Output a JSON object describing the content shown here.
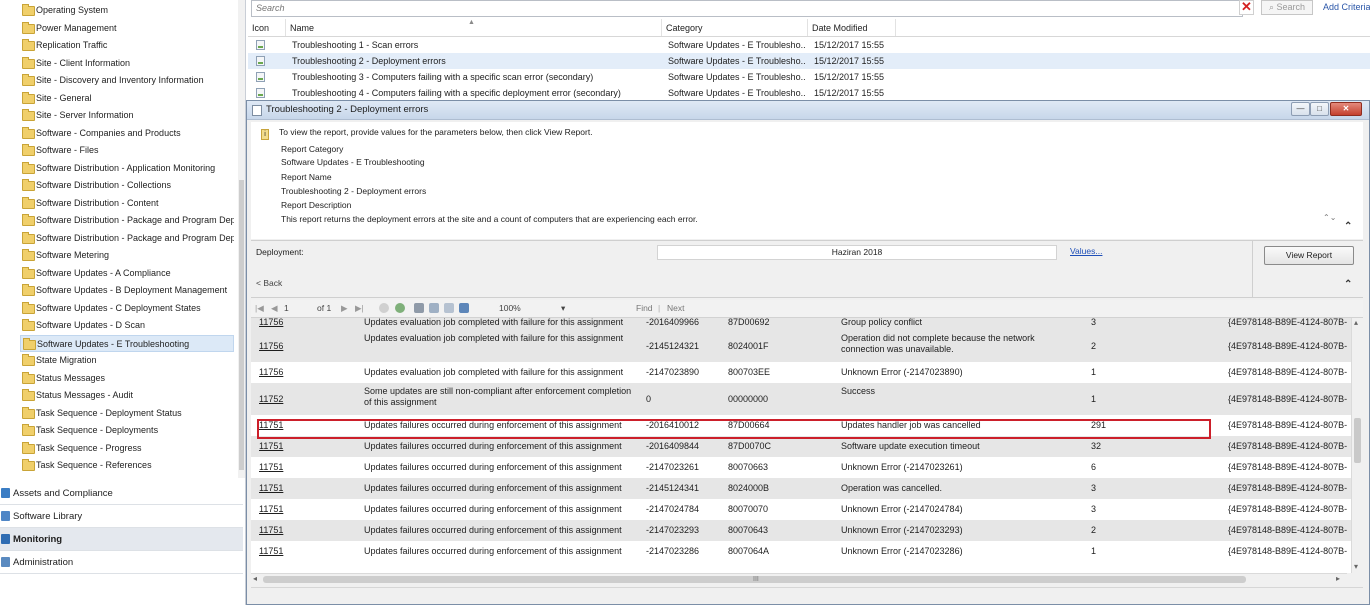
{
  "tree": {
    "items": [
      {
        "label": "Operating System",
        "selected": false
      },
      {
        "label": "Power Management",
        "selected": false
      },
      {
        "label": "Replication Traffic",
        "selected": false
      },
      {
        "label": "Site - Client Information",
        "selected": false
      },
      {
        "label": "Site - Discovery and Inventory Information",
        "selected": false
      },
      {
        "label": "Site - General",
        "selected": false
      },
      {
        "label": "Site - Server Information",
        "selected": false
      },
      {
        "label": "Software - Companies and Products",
        "selected": false
      },
      {
        "label": "Software - Files",
        "selected": false
      },
      {
        "label": "Software Distribution - Application Monitoring",
        "selected": false
      },
      {
        "label": "Software Distribution - Collections",
        "selected": false
      },
      {
        "label": "Software Distribution - Content",
        "selected": false
      },
      {
        "label": "Software Distribution - Package and Program Deplc",
        "selected": false
      },
      {
        "label": "Software Distribution - Package and Program Deplc",
        "selected": false
      },
      {
        "label": "Software Metering",
        "selected": false
      },
      {
        "label": "Software Updates - A Compliance",
        "selected": false
      },
      {
        "label": "Software Updates - B Deployment Management",
        "selected": false
      },
      {
        "label": "Software Updates - C Deployment States",
        "selected": false
      },
      {
        "label": "Software Updates - D Scan",
        "selected": false
      },
      {
        "label": "Software Updates - E Troubleshooting",
        "selected": true
      },
      {
        "label": "State Migration",
        "selected": false
      },
      {
        "label": "Status Messages",
        "selected": false
      },
      {
        "label": "Status Messages - Audit",
        "selected": false
      },
      {
        "label": "Task Sequence - Deployment Status",
        "selected": false
      },
      {
        "label": "Task Sequence - Deployments",
        "selected": false
      },
      {
        "label": "Task Sequence - Progress",
        "selected": false
      },
      {
        "label": "Task Sequence - References",
        "selected": false
      }
    ]
  },
  "workspaces": [
    {
      "label": "Assets and Compliance",
      "color": "#3b7dc4",
      "active": false
    },
    {
      "label": "Software Library",
      "color": "#4f86c6",
      "active": false
    },
    {
      "label": "Monitoring",
      "color": "#2f6db3",
      "active": true
    },
    {
      "label": "Administration",
      "color": "#5a8ac0",
      "active": false
    }
  ],
  "search": {
    "placeholder": "Search",
    "clear_symbol": "✕",
    "button_label": "Search",
    "search_glyph": "⌕",
    "add_criteria": "Add Criteria"
  },
  "list": {
    "columns": {
      "icon": "Icon",
      "name": "Name",
      "category": "Category",
      "date": "Date Modified"
    },
    "sort_glyph": "▲",
    "rows": [
      {
        "name": "Troubleshooting 1 - Scan errors",
        "category": "Software Updates - E Troublesho...",
        "date": "15/12/2017 15:55",
        "selected": false
      },
      {
        "name": "Troubleshooting 2 - Deployment errors",
        "category": "Software Updates - E Troublesho...",
        "date": "15/12/2017 15:55",
        "selected": true
      },
      {
        "name": "Troubleshooting 3 - Computers failing with a specific scan error (secondary)",
        "category": "Software Updates - E Troublesho...",
        "date": "15/12/2017 15:55",
        "selected": false
      },
      {
        "name": "Troubleshooting 4 - Computers failing with a specific deployment error (secondary)",
        "category": "Software Updates - E Troublesho...",
        "date": "15/12/2017 15:55",
        "selected": false
      }
    ]
  },
  "report_window": {
    "title": "Troubleshooting 2 - Deployment errors",
    "minimize": "—",
    "maximize": "□",
    "close": "✕",
    "info": {
      "icon": "i",
      "instruction": "To view the report, provide values for the parameters below, then click View Report.",
      "category_label": "Report Category",
      "category_value": "Software Updates - E Troubleshooting",
      "name_label": "Report Name",
      "name_value": "Troubleshooting 2 - Deployment errors",
      "description_label": "Report Description",
      "description_value": "This report returns the deployment errors at the site and a count of computers that are experiencing each error.",
      "scroll_glyph": "⌃⌄",
      "collapse_glyph": "⌃"
    },
    "params": {
      "deployment_label": "Deployment:",
      "deployment_value": "Haziran 2018",
      "values_link": "Values...",
      "back_link": "< Back",
      "view_report": "View Report",
      "collapse_glyph": "⌃"
    },
    "toolbar": {
      "first": "|◀",
      "prev": "◀",
      "page": "1",
      "of": "of 1",
      "next_page": "▶",
      "last": "▶|",
      "zoom": "100%",
      "zoom_arrow": "▾",
      "find": "Find",
      "next": "Next"
    },
    "table": {
      "rows": [
        {
          "id": "11756",
          "desc": "Updates evaluation job completed with failure for this assignment",
          "code": "-2016409966",
          "hex": "87D00692",
          "error": "Group policy conflict",
          "count": "3",
          "guid": "{4E978148-B89E-4124-807B-"
        },
        {
          "id": "11756",
          "desc": "Updates evaluation job completed with failure for this assignment",
          "code": "-2145124321",
          "hex": "8024001F",
          "error": "Operation did not complete because the network connection was unavailable.",
          "count": "2",
          "guid": "{4E978148-B89E-4124-807B-"
        },
        {
          "id": "11756",
          "desc": "Updates evaluation job completed with failure for this assignment",
          "code": "-2147023890",
          "hex": "800703EE",
          "error": "Unknown Error (-2147023890)",
          "count": "1",
          "guid": "{4E978148-B89E-4124-807B-"
        },
        {
          "id": "11752",
          "desc": "Some updates are still non-compliant after enforcement completion of this assignment",
          "code": "0",
          "hex": "00000000",
          "error": "Success",
          "count": "1",
          "guid": "{4E978148-B89E-4124-807B-"
        },
        {
          "id": "11751",
          "desc": "Updates failures occurred during enforcement of this assignment",
          "code": "-2016410012",
          "hex": "87D00664",
          "error": "Updates handler job was cancelled",
          "count": "291",
          "guid": "{4E978148-B89E-4124-807B-"
        },
        {
          "id": "11751",
          "desc": "Updates failures occurred during enforcement of this assignment",
          "code": "-2016409844",
          "hex": "87D0070C",
          "error": "Software update execution timeout",
          "count": "32",
          "guid": "{4E978148-B89E-4124-807B-"
        },
        {
          "id": "11751",
          "desc": "Updates failures occurred during enforcement of this assignment",
          "code": "-2147023261",
          "hex": "80070663",
          "error": "Unknown Error (-2147023261)",
          "count": "6",
          "guid": "{4E978148-B89E-4124-807B-"
        },
        {
          "id": "11751",
          "desc": "Updates failures occurred during enforcement of this assignment",
          "code": "-2145124341",
          "hex": "8024000B",
          "error": "Operation was cancelled.",
          "count": "3",
          "guid": "{4E978148-B89E-4124-807B-"
        },
        {
          "id": "11751",
          "desc": "Updates failures occurred during enforcement of this assignment",
          "code": "-2147024784",
          "hex": "80070070",
          "error": "Unknown Error (-2147024784)",
          "count": "3",
          "guid": "{4E978148-B89E-4124-807B-"
        },
        {
          "id": "11751",
          "desc": "Updates failures occurred during enforcement of this assignment",
          "code": "-2147023293",
          "hex": "80070643",
          "error": "Unknown Error (-2147023293)",
          "count": "2",
          "guid": "{4E978148-B89E-4124-807B-"
        },
        {
          "id": "11751",
          "desc": "Updates failures occurred during enforcement of this assignment",
          "code": "-2147023286",
          "hex": "8007064A",
          "error": "Unknown Error (-2147023286)",
          "count": "1",
          "guid": "{4E978148-B89E-4124-807B-"
        }
      ]
    },
    "hscroll_grip": "III",
    "hscroll_left": "◂",
    "hscroll_right": "▸",
    "vscroll_up": "▴",
    "vscroll_down": "▾"
  }
}
